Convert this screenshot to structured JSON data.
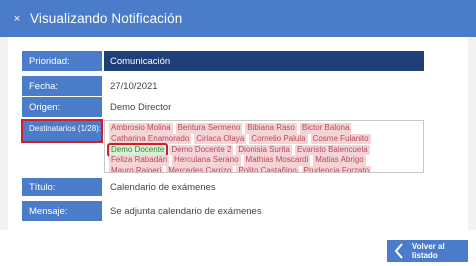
{
  "header": {
    "close_icon": "×",
    "title": "Visualizando Notificación"
  },
  "fields": {
    "prioridad": {
      "label": "Prioridad:",
      "value": "Comunicación"
    },
    "fecha": {
      "label": "Fecha:",
      "value": "27/10/2021"
    },
    "origen": {
      "label": "Origen:",
      "value": "Demo Director"
    },
    "destinatarios": {
      "label": "Destinatarios (1/28):"
    },
    "titulo": {
      "label": "Título:",
      "value": "Calendario de exámenes"
    },
    "mensaje": {
      "label": "Mensaje:",
      "value": "Se adjunta calendario de exámenes"
    }
  },
  "recipients": [
    [
      "Ambrosio Molina",
      "Bentura Sermeno",
      "Bibiana Raso",
      "Bictor Balona"
    ],
    [
      "Catharina Enamorado",
      "Ciriaca Olaya",
      "Cornelio Palula",
      "Cosme Fulanito"
    ],
    [
      "Demo Docente",
      "Demo Docente 2",
      "Dionisia Surita",
      "Evaristo Balencuela"
    ],
    [
      "Feliza Rabadán",
      "Herculana Serano",
      "Mathias Moscardi",
      "Matias Abrigo"
    ],
    [
      "Mauro Raineri",
      "Mercedes Carrizo",
      "Polito Castañino",
      "Prudencia Forzato"
    ]
  ],
  "active_recipient": "Demo Docente",
  "footer": {
    "back_label": "Volver al listado",
    "back_icon": "chevron-left-icon"
  },
  "colors": {
    "header": "#4a7cc9",
    "label_bg": "#4a7cc9",
    "priority_bg": "#1e3f78",
    "tag_bg": "#f4d4d6",
    "tag_text": "#b94a55",
    "active_tag_bg": "#d9f0d6",
    "active_tag_text": "#2e8b3c",
    "highlight_border": "#d11f2a"
  }
}
